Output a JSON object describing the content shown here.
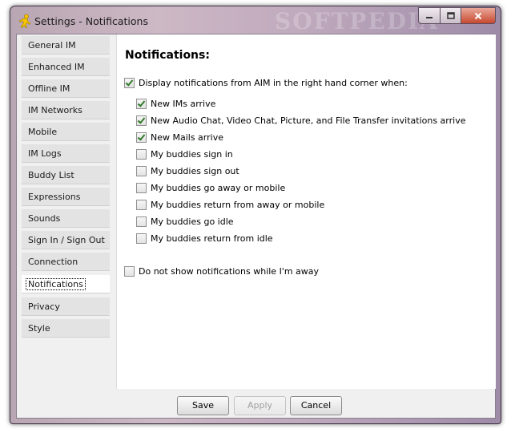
{
  "window": {
    "title": "Settings - Notifications",
    "watermark": "SOFTPEDIA"
  },
  "icons": {
    "app": "aim-running-man-icon",
    "minimize": "minimize-icon",
    "maximize": "maximize-icon",
    "close": "close-icon"
  },
  "colors": {
    "check": "#2f7a28",
    "frame": "#bfa9bd",
    "close_button": "#c8482f"
  },
  "sidebar": {
    "items": [
      {
        "label": "General IM"
      },
      {
        "label": "Enhanced IM"
      },
      {
        "label": "Offline IM"
      },
      {
        "label": "IM Networks"
      },
      {
        "label": "Mobile"
      },
      {
        "label": "IM Logs"
      },
      {
        "label": "Buddy List"
      },
      {
        "label": "Expressions"
      },
      {
        "label": "Sounds"
      },
      {
        "label": "Sign In / Sign Out"
      },
      {
        "label": "Connection"
      },
      {
        "label": "Notifications"
      },
      {
        "label": "Privacy"
      },
      {
        "label": "Style"
      }
    ],
    "selected": "Notifications"
  },
  "panel": {
    "heading": "Notifications:",
    "main_option": {
      "label": "Display notifications from AIM in the right hand corner when:",
      "checked": true
    },
    "options": [
      {
        "label": "New IMs arrive",
        "checked": true
      },
      {
        "label": "New Audio Chat, Video Chat, Picture, and File Transfer invitations arrive",
        "checked": true
      },
      {
        "label": "New Mails arrive",
        "checked": true
      },
      {
        "label": "My buddies sign in",
        "checked": false
      },
      {
        "label": "My buddies sign out",
        "checked": false
      },
      {
        "label": "My buddies go away or mobile",
        "checked": false
      },
      {
        "label": "My buddies return from away or mobile",
        "checked": false
      },
      {
        "label": "My buddies go idle",
        "checked": false
      },
      {
        "label": "My buddies return from idle",
        "checked": false
      }
    ],
    "away_option": {
      "label": "Do not show notifications while I'm away",
      "checked": false
    }
  },
  "buttons": {
    "save": "Save",
    "apply": "Apply",
    "cancel": "Cancel",
    "apply_enabled": false
  }
}
